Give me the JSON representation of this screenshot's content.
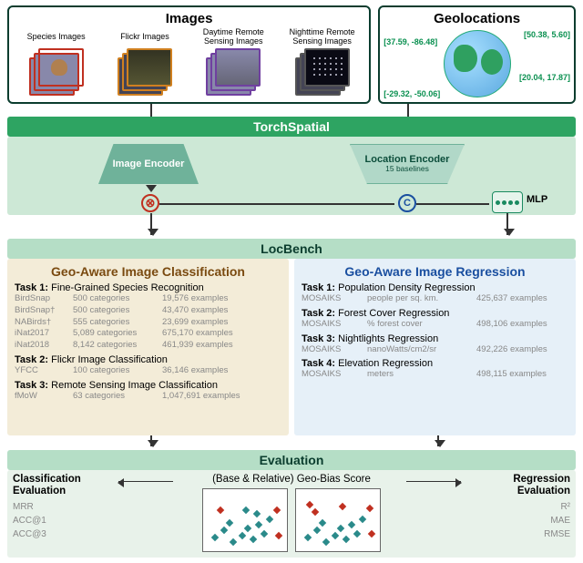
{
  "top": {
    "images_title": "Images",
    "geo_title": "Geolocations",
    "cols": {
      "species": "Species Images",
      "flickr": "Flickr Images",
      "daytime": "Daytime Remote Sensing Images",
      "night": "Nighttime Remote Sensing Images"
    },
    "coords": {
      "a": "[37.59, -86.48]",
      "b": "[50.38, 5.60]",
      "c": "[20.04, 17.87]",
      "d": "[-29.32, -50.06]"
    }
  },
  "torchspatial": {
    "band": "TorchSpatial",
    "img_enc": "Image Encoder",
    "loc_enc": "Location Encoder",
    "loc_sub": "15 baselines",
    "mlp": "MLP"
  },
  "locbench": {
    "band": "LocBench",
    "left_title": "Geo-Aware Image Classification",
    "right_title": "Geo-Aware Image Regression",
    "left": {
      "t1": {
        "label": "Task 1:",
        "name": "Fine-Grained Species Recognition",
        "rows": [
          {
            "a": "BirdSnap",
            "b": "500 categories",
            "c": "19,576 examples"
          },
          {
            "a": "BirdSnap†",
            "b": "500 categories",
            "c": "43,470 examples"
          },
          {
            "a": "NABirds†",
            "b": "555 categories",
            "c": "23,699 examples"
          },
          {
            "a": "iNat2017",
            "b": "5,089 categories",
            "c": "675,170 examples"
          },
          {
            "a": "iNat2018",
            "b": "8,142 categories",
            "c": "461,939 examples"
          }
        ]
      },
      "t2": {
        "label": "Task 2:",
        "name": "Flickr Image Classification",
        "rows": [
          {
            "a": "YFCC",
            "b": "100 categories",
            "c": "36,146 examples"
          }
        ]
      },
      "t3": {
        "label": "Task 3:",
        "name": "Remote Sensing Image Classification",
        "rows": [
          {
            "a": "fMoW",
            "b": "63 categories",
            "c": "1,047,691 examples"
          }
        ]
      }
    },
    "right": {
      "t1": {
        "label": "Task 1:",
        "name": "Population Density Regression",
        "rows": [
          {
            "a": "MOSAIKS",
            "b": "people per sq. km.",
            "c": "425,637 examples"
          }
        ]
      },
      "t2": {
        "label": "Task 2:",
        "name": "Forest Cover Regression",
        "rows": [
          {
            "a": "MOSAIKS",
            "b": "% forest cover",
            "c": "498,106 examples"
          }
        ]
      },
      "t3": {
        "label": "Task 3:",
        "name": "Nightlights Regression",
        "rows": [
          {
            "a": "MOSAIKS",
            "b": "nanoWatts/cm2/sr",
            "c": "492,226 examples"
          }
        ]
      },
      "t4": {
        "label": "Task 4:",
        "name": "Elevation Regression",
        "rows": [
          {
            "a": "MOSAIKS",
            "b": "meters",
            "c": "498,115 examples"
          }
        ]
      }
    }
  },
  "evaluation": {
    "band": "Evaluation",
    "cls_title": "Classification Evaluation",
    "reg_title": "Regression Evaluation",
    "mid_title": "(Base & Relative) Geo-Bias Score",
    "cls_metrics": [
      "MRR",
      "ACC@1",
      "ACC@3"
    ],
    "reg_metrics": [
      "R²",
      "MAE",
      "RMSE"
    ]
  }
}
